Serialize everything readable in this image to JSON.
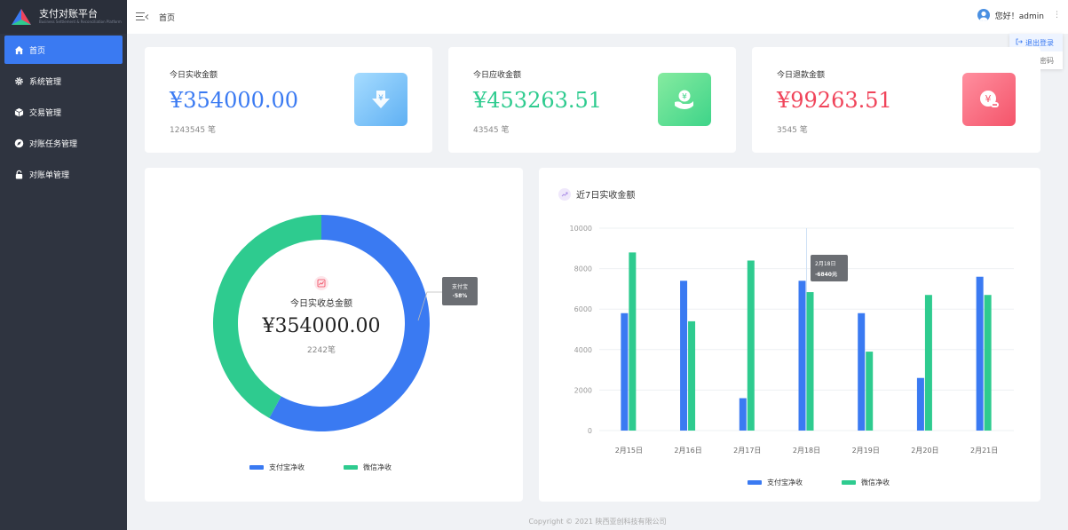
{
  "app": {
    "title": "支付对账平台",
    "subtitle": "Business Settlement & Reconciliation Platform"
  },
  "sidebar": {
    "items": [
      {
        "label": "首页",
        "icon": "home-icon",
        "active": true
      },
      {
        "label": "系统管理",
        "icon": "gear-icon",
        "active": false
      },
      {
        "label": "交易管理",
        "icon": "cube-icon",
        "active": false
      },
      {
        "label": "对账任务管理",
        "icon": "compass-icon",
        "active": false
      },
      {
        "label": "对账单管理",
        "icon": "lock-icon",
        "active": false
      }
    ]
  },
  "header": {
    "breadcrumb": "首页",
    "greeting": "您好！admin",
    "more": "⋮"
  },
  "dropdown": {
    "items": [
      {
        "label": "退出登录",
        "icon": "logout-icon"
      },
      {
        "label": "修改密码",
        "icon": "edit-icon"
      }
    ]
  },
  "stats": [
    {
      "title": "今日实收金额",
      "value": "¥354000.00",
      "count": "1243545 笔",
      "color": "#3a7af2",
      "icon": "download-yen-icon"
    },
    {
      "title": "今日应收金额",
      "value": "¥453263.51",
      "count": "43545 笔",
      "color": "#2ecb8f",
      "icon": "hand-yen-icon"
    },
    {
      "title": "今日退款金额",
      "value": "¥99263.51",
      "count": "3545 笔",
      "color": "#f0445a",
      "icon": "yen-minus-icon"
    }
  ],
  "donut": {
    "center_title": "今日实收总金额",
    "center_value": "¥354000.00",
    "center_count": "2242笔",
    "tooltip_name": "支付宝",
    "tooltip_value": "·58%",
    "legend": [
      {
        "name": "支付宝净收",
        "color": "#3a7af2"
      },
      {
        "name": "微信净收",
        "color": "#2ecb8f"
      }
    ]
  },
  "bar_panel": {
    "title": "近7日实收金额",
    "tooltip_date": "2月18日",
    "tooltip_value": "·6840元"
  },
  "chart_data": [
    {
      "type": "pie",
      "title": "今日实收总金额",
      "labels": [
        "支付宝净收",
        "微信净收"
      ],
      "values": [
        58,
        42
      ],
      "colors": [
        "#3a7af2",
        "#2ecb8f"
      ]
    },
    {
      "type": "bar",
      "title": "近7日实收金额",
      "categories": [
        "2月15日",
        "2月16日",
        "2月17日",
        "2月18日",
        "2月19日",
        "2月20日",
        "2月21日"
      ],
      "series": [
        {
          "name": "支付宝净收",
          "color": "#3a7af2",
          "values": [
            5800,
            7400,
            1600,
            7400,
            5800,
            2600,
            7600
          ]
        },
        {
          "name": "微信净收",
          "color": "#2ecb8f",
          "values": [
            8800,
            5400,
            8400,
            6840,
            3900,
            6700,
            6700
          ]
        }
      ],
      "yticks": [
        0,
        2000,
        4000,
        6000,
        8000,
        10000
      ],
      "ylim": [
        0,
        10000
      ],
      "legend_position": "bottom",
      "grid": true
    }
  ],
  "footer": {
    "text": "Copyright © 2021 陕西亚创科技有限公司"
  }
}
